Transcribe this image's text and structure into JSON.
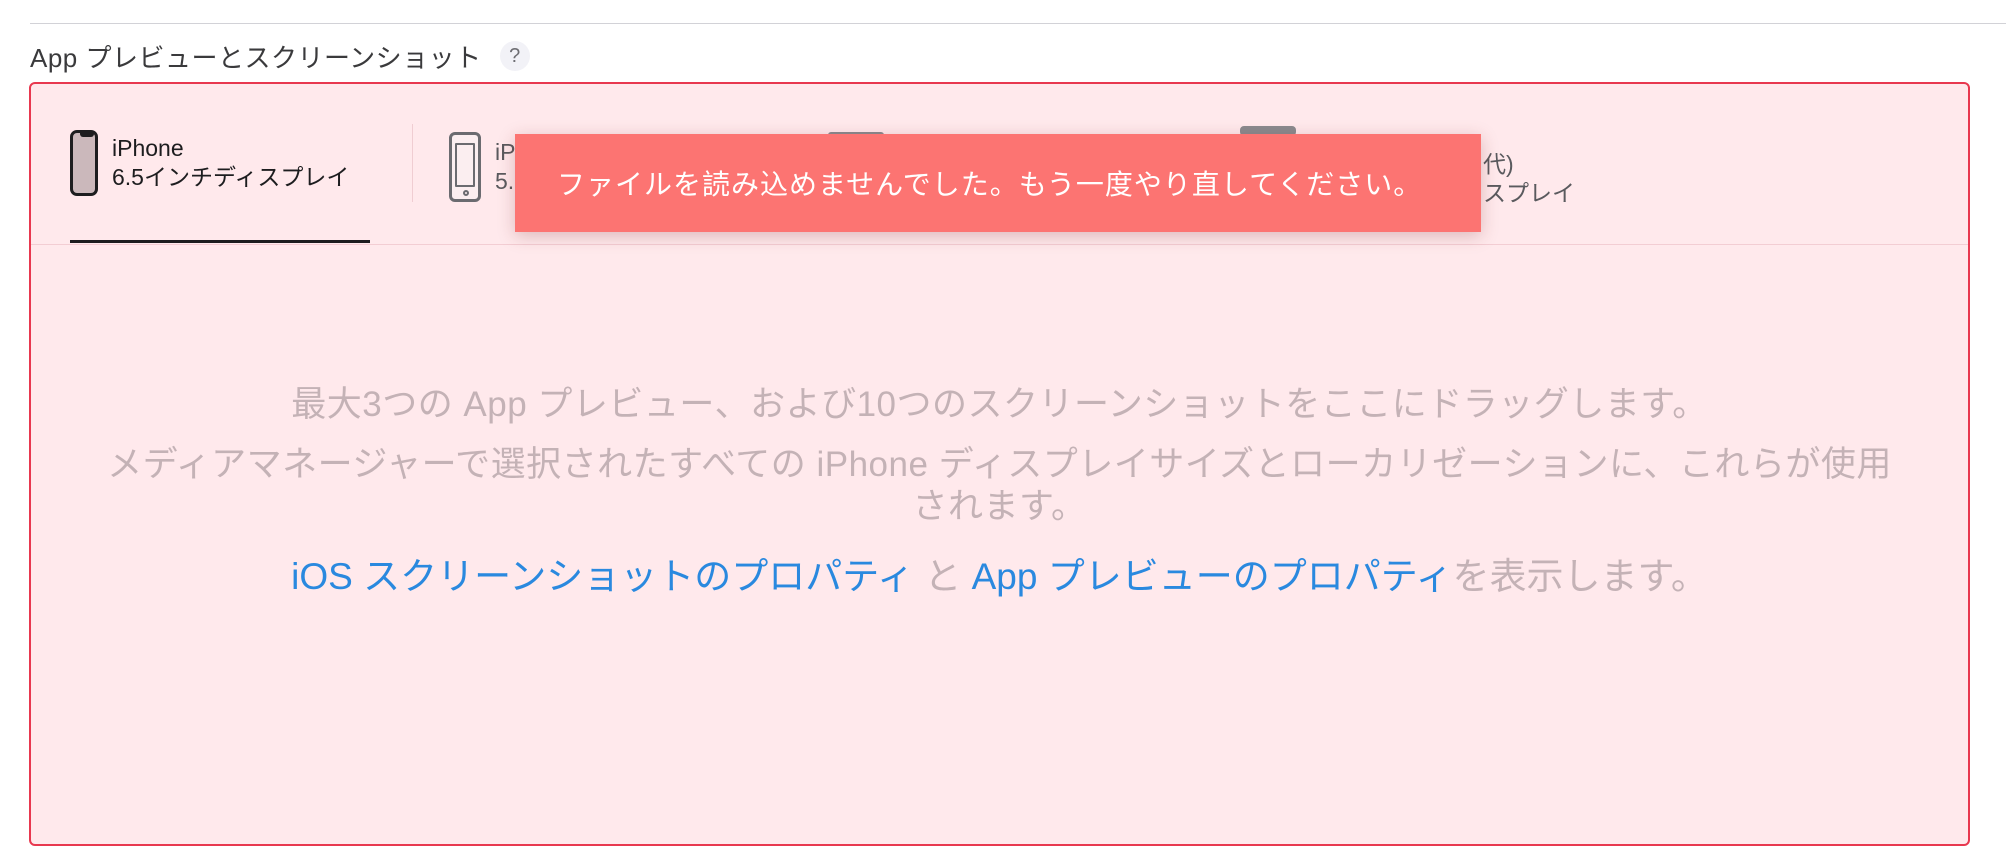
{
  "section": {
    "title": "App プレビューとスクリーンショット",
    "help_icon": "?"
  },
  "tabs": [
    {
      "line1": "iPhone",
      "line2": "6.5インチディスプレイ",
      "icon": "iphone-x-icon",
      "active": true
    },
    {
      "line1": "iP",
      "line2": "5.",
      "icon": "iphone-home-button-icon",
      "active": false
    },
    {
      "line1": "代)",
      "line2": "スプレイ",
      "icon": "ipad-icon",
      "active": false
    }
  ],
  "drop_zone": {
    "line1": "最大3つの App プレビュー、および10つのスクリーンショットをここにドラッグします。",
    "line2": "メディアマネージャーで選択されたすべての iPhone ディスプレイサイズとローカリゼーションに、これらが使用されます。",
    "link1": "iOS スクリーンショットのプロパティ",
    "connector": " と ",
    "link2": "App プレビューのプロパティ",
    "suffix": "を表示します。"
  },
  "toast": {
    "message": "ファイルを読み込めませんでした。もう一度やり直してください。"
  },
  "colors": {
    "error_border": "#e8384f",
    "panel_bg": "#ffe9ec",
    "toast_bg": "#fc7472",
    "link": "#2a89df"
  }
}
